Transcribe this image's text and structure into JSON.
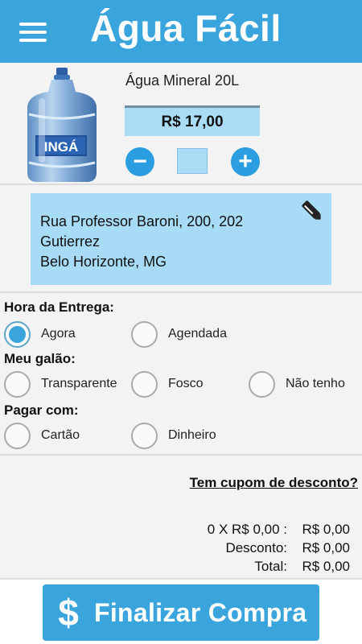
{
  "app": {
    "title": "Água Fácil"
  },
  "product": {
    "name": "Água Mineral 20L",
    "price": "R$ 17,00",
    "brand": "INGÁ",
    "quantity": "",
    "minus_symbol": "−",
    "plus_symbol": "+"
  },
  "address": {
    "line1": "Rua Professor Baroni, 200, 202",
    "line2": "Gutierrez",
    "line3": "Belo Horizonte, MG"
  },
  "delivery": {
    "label": "Hora da Entrega:",
    "options": [
      "Agora",
      "Agendada"
    ],
    "selected": "Agora"
  },
  "gallon": {
    "label": "Meu galão:",
    "options": [
      "Transparente",
      "Fosco",
      "Não tenho"
    ],
    "selected": ""
  },
  "payment": {
    "label": "Pagar com:",
    "options": [
      "Cartão",
      "Dinheiro"
    ],
    "selected": ""
  },
  "coupon": {
    "label": "Tem cupom de desconto?"
  },
  "totals": {
    "subtotal_label": "0 X R$ 0,00 :",
    "subtotal_value": "R$ 0,00",
    "discount_label": "Desconto:",
    "discount_value": "R$ 0,00",
    "total_label": "Total:",
    "total_value": "R$ 0,00"
  },
  "checkout": {
    "icon_symbol": "$",
    "label": "Finalizar Compra"
  },
  "colors": {
    "primary": "#3aa4dc",
    "light_blue": "#a7dbf6",
    "background": "#f3f3f3"
  },
  "icons": [
    "menu-icon",
    "water-jug-icon",
    "edit-pen-icon",
    "dollar-icon"
  ]
}
